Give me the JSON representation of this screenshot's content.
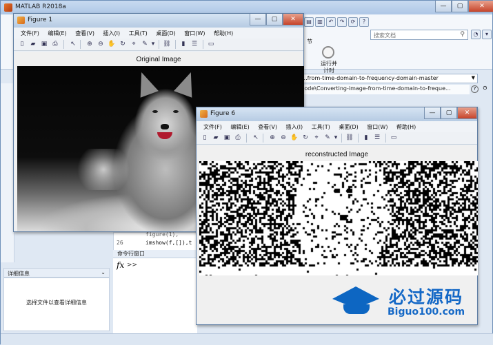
{
  "main_window": {
    "title": "MATLAB R2018a",
    "search_placeholder": "搜索文档",
    "ribbon_section_label": "节",
    "run_timer_label": "运行并\n计时",
    "path_primary": "...from-time-domain-to-frequency-domain-master",
    "path_secondary": "code\\Converting-image-from-time-domain-to-freque...",
    "editor_line_number": "26",
    "editor_code": "imshow(f,[]),t",
    "editor_partial_above": "figure(1),",
    "cmd_header": "命令行窗口",
    "cmd_prompt": ">>",
    "detail_header": "详细信息",
    "detail_message": "选择文件以查看详细信息"
  },
  "figure1": {
    "title": "Figure 1",
    "menu": [
      "文件(F)",
      "编辑(E)",
      "查看(V)",
      "插入(I)",
      "工具(T)",
      "桌面(D)",
      "窗口(W)",
      "帮助(H)"
    ],
    "axes_title": "Original Image"
  },
  "figure6": {
    "title": "Figure 6",
    "menu": [
      "文件(F)",
      "编辑(E)",
      "查看(V)",
      "插入(I)",
      "工具(T)",
      "桌面(D)",
      "窗口(W)",
      "帮助(H)"
    ],
    "axes_title": "reconstructed Image"
  },
  "watermark": {
    "brand_cn": "必过源码",
    "brand_url": "Biguo100.com"
  },
  "colors": {
    "accent": "#1468c6",
    "titlebar": "#b6cbe3"
  }
}
